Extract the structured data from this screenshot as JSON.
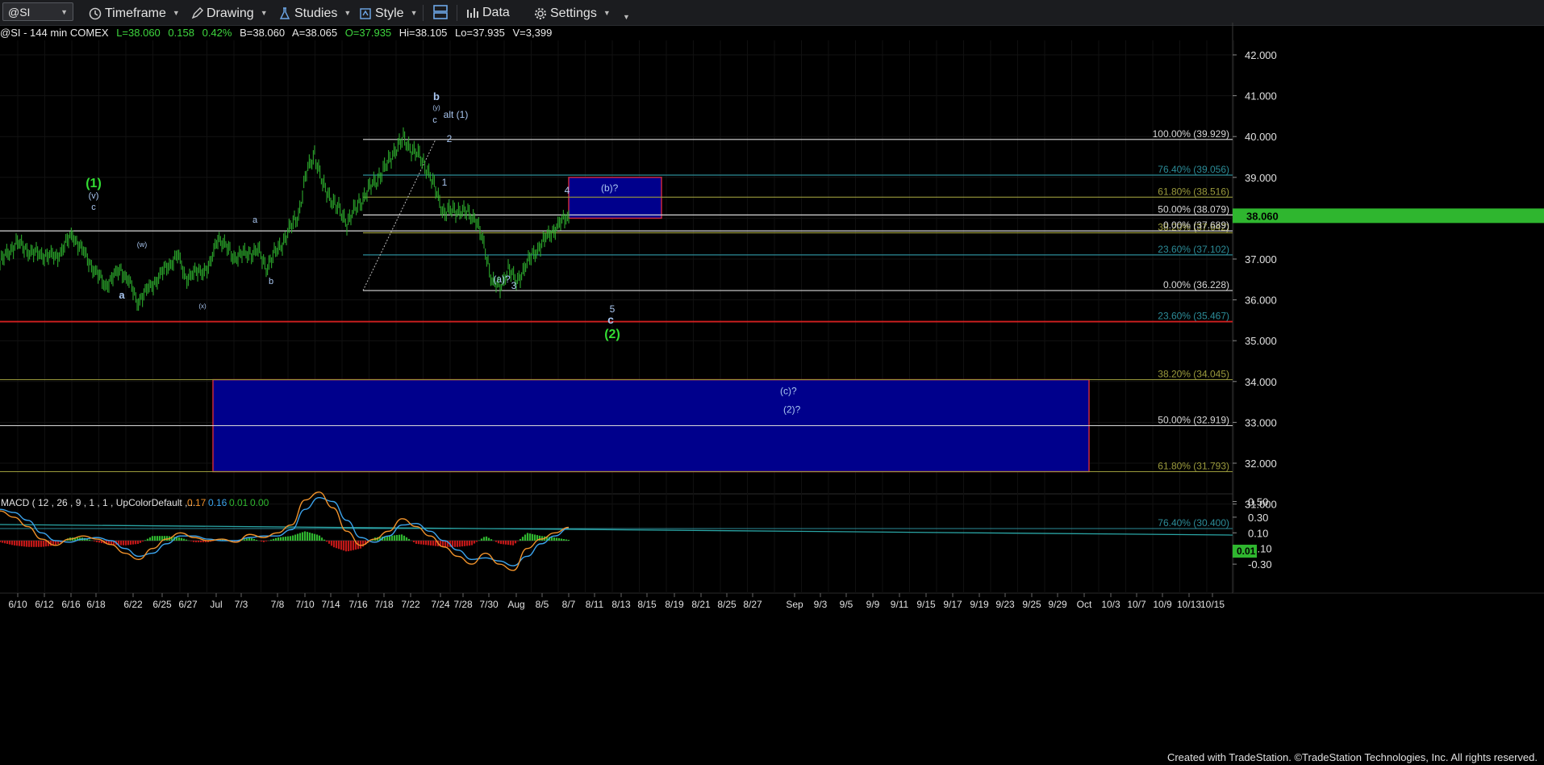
{
  "toolbar": {
    "symbol": "@SI",
    "timeframe_label": "Timeframe",
    "drawing_label": "Drawing",
    "studies_label": "Studies",
    "style_label": "Style",
    "data_label": "Data",
    "settings_label": "Settings"
  },
  "info_bar": {
    "symbol_desc": "@SI - 144 min  COMEX",
    "last": "L=38.060",
    "change": "0.158",
    "change_pct": "0.42%",
    "bid": "B=38.060",
    "ask": "A=38.065",
    "open": "O=37.935",
    "high": "Hi=38.105",
    "low": "Lo=37.935",
    "volume": "V=3,399"
  },
  "colors": {
    "background": "#000000",
    "price_bars": "#2fb62f",
    "fib_white": "#d8d8d8",
    "fib_teal": "#2c8c98",
    "fib_olive": "#9a9a3c",
    "support_red": "#d22020",
    "target_box_fill": "#00008c",
    "target_box_border": "#c8283c",
    "wave_label_green": "#33dd33",
    "wave_label_blue": "#a9c6f0",
    "macd_line": "#f0922b",
    "signal_line": "#3ba3ec",
    "hist_pos": "#2fb62f",
    "hist_neg": "#c01818",
    "trendline": "#2aa6a6",
    "last_price_tag": "#2fb62f"
  },
  "chart_data": [
    {
      "type": "candlestick-ohlc",
      "title": "@SI - 144 min COMEX",
      "ylim": [
        30.2,
        42.6
      ],
      "y_ticks": [
        "42.000",
        "41.000",
        "40.000",
        "39.000",
        "38.000",
        "37.000",
        "36.000",
        "35.000",
        "34.000",
        "33.000",
        "32.000",
        "31.000"
      ],
      "x_tick_labels": [
        "6/10",
        "6/12",
        "6/16",
        "6/18",
        "6/22",
        "6/25",
        "6/27",
        "Jul",
        "7/3",
        "7/8",
        "7/10",
        "7/14",
        "7/16",
        "7/18",
        "7/22",
        "7/24",
        "7/28",
        "7/30",
        "Aug",
        "8/5",
        "8/7",
        "8/11",
        "8/13",
        "8/15",
        "8/19",
        "8/21",
        "8/25",
        "8/27",
        "Sep",
        "9/3",
        "9/5",
        "9/9",
        "9/11",
        "9/15",
        "9/17",
        "9/19",
        "9/23",
        "9/25",
        "9/29",
        "Oct",
        "10/3",
        "10/7",
        "10/9",
        "10/13",
        "10/15"
      ],
      "price_path": [
        [
          0,
          36.9
        ],
        [
          4,
          37.4
        ],
        [
          8,
          37.15
        ],
        [
          14,
          37.05
        ],
        [
          18,
          37.6
        ],
        [
          22,
          36.95
        ],
        [
          26,
          36.35
        ],
        [
          30,
          36.75
        ],
        [
          32,
          36.45
        ],
        [
          34,
          35.95
        ],
        [
          38,
          36.4
        ],
        [
          44,
          37.1
        ],
        [
          46,
          36.55
        ],
        [
          52,
          36.8
        ],
        [
          54,
          37.55
        ],
        [
          58,
          37.05
        ],
        [
          64,
          37.2
        ],
        [
          66,
          36.8
        ],
        [
          70,
          37.4
        ],
        [
          74,
          38.1
        ],
        [
          76,
          39.1
        ],
        [
          78,
          39.6
        ],
        [
          80,
          38.8
        ],
        [
          84,
          38.2
        ],
        [
          86,
          37.9
        ],
        [
          90,
          38.5
        ],
        [
          96,
          39.3
        ],
        [
          98,
          39.7
        ],
        [
          100,
          39.92
        ],
        [
          104,
          39.5
        ],
        [
          106,
          39.2
        ],
        [
          110,
          38.15
        ],
        [
          114,
          38.2
        ],
        [
          118,
          38.0
        ],
        [
          120,
          37.3
        ],
        [
          122,
          36.5
        ],
        [
          124,
          36.25
        ],
        [
          126,
          36.8
        ],
        [
          128,
          36.4
        ],
        [
          130,
          36.8
        ],
        [
          134,
          37.35
        ],
        [
          138,
          37.8
        ],
        [
          141,
          38.06
        ]
      ],
      "last_price": "38.060",
      "fib_levels_upper": [
        {
          "label": "100.00% (39.929)",
          "value": 39.929,
          "color": "white"
        },
        {
          "label": "76.40% (39.056)",
          "value": 39.056,
          "color": "teal"
        },
        {
          "label": "61.80% (38.516)",
          "value": 38.516,
          "color": "olive"
        },
        {
          "label": "50.00% (38.079)",
          "value": 38.079,
          "color": "white"
        },
        {
          "label": "38.20% (37.642)",
          "value": 37.642,
          "color": "olive"
        },
        {
          "label": "23.60% (37.102)",
          "value": 37.102,
          "color": "teal"
        },
        {
          "label": "0.00% (36.228)",
          "value": 36.228,
          "color": "white"
        }
      ],
      "horizontal_line_upper": {
        "label": "0.00% (37.689)",
        "value": 37.689
      },
      "support_line": {
        "label": "23.60% (35.467)",
        "value": 35.467
      },
      "fib_levels_lower": [
        {
          "label": "38.20% (34.045)",
          "value": 34.045,
          "color": "olive"
        },
        {
          "label": "50.00% (32.919)",
          "value": 32.919,
          "color": "white"
        },
        {
          "label": "61.80% (31.793)",
          "value": 31.793,
          "color": "olive"
        },
        {
          "label": "76.40% (30.400)",
          "value": 30.4,
          "color": "teal"
        }
      ],
      "target_boxes": [
        {
          "label": "(b)?",
          "top": 39.0,
          "bottom": 38.0
        },
        {
          "label": "(c)?",
          "label2": "(2)?",
          "top": 34.045,
          "bottom": 31.793
        }
      ],
      "wave_labels": [
        {
          "text": "(1)",
          "color": "green"
        },
        {
          "text": "(v)",
          "color": "blue"
        },
        {
          "text": "c",
          "color": "blue"
        },
        {
          "text": "a",
          "color": "blue"
        },
        {
          "text": "(w)",
          "color": "blue"
        },
        {
          "text": "(x)",
          "color": "blue"
        },
        {
          "text": "a",
          "color": "blue"
        },
        {
          "text": "b",
          "color": "blue"
        },
        {
          "text": "b",
          "color": "blue"
        },
        {
          "text": "(y)",
          "color": "blue"
        },
        {
          "text": "c",
          "color": "blue"
        },
        {
          "text": "alt (1)",
          "color": "blue"
        },
        {
          "text": "2",
          "color": "blue"
        },
        {
          "text": "1",
          "color": "blue"
        },
        {
          "text": "4",
          "color": "blue"
        },
        {
          "text": "(a)?",
          "color": "blue"
        },
        {
          "text": "3",
          "color": "blue"
        },
        {
          "text": "5",
          "color": "blue"
        },
        {
          "text": "c",
          "color": "blue"
        },
        {
          "text": "(2)",
          "color": "green"
        }
      ]
    },
    {
      "type": "line",
      "title": "MACD ( 12 , 26 , 9 , 1 , 1 , UpColorDefault ,...",
      "legend_values": [
        "0.17",
        "0.16",
        "0.01",
        "0.00"
      ],
      "ylim": [
        -0.42,
        0.65
      ],
      "y_ticks": [
        "0.50",
        "0.30",
        "0.10",
        "-0.10",
        "-0.30"
      ],
      "current_value": "0.01",
      "series": [
        {
          "values": [
            0.38,
            0.3,
            0.18,
            0.02,
            -0.06,
            0.02,
            0.06,
            0.02,
            -0.05,
            -0.16,
            -0.24,
            -0.1,
            0.02,
            0.1,
            0.04,
            0.0,
            0.02,
            -0.02,
            0.08,
            0.04,
            0.1,
            0.2,
            0.52,
            0.62,
            0.42,
            0.12,
            -0.06,
            0.02,
            0.12,
            0.28,
            0.18,
            0.06,
            -0.08,
            -0.2,
            -0.3,
            -0.16,
            -0.3,
            -0.38,
            -0.1,
            0.02,
            0.1,
            0.17
          ]
        },
        {
          "values": [
            0.4,
            0.36,
            0.26,
            0.1,
            0.0,
            -0.02,
            0.02,
            0.04,
            0.0,
            -0.1,
            -0.2,
            -0.16,
            -0.04,
            0.06,
            0.06,
            0.02,
            0.0,
            0.0,
            0.04,
            0.06,
            0.06,
            0.14,
            0.4,
            0.55,
            0.5,
            0.26,
            0.04,
            -0.02,
            0.06,
            0.2,
            0.22,
            0.12,
            0.0,
            -0.12,
            -0.24,
            -0.22,
            -0.26,
            -0.32,
            -0.2,
            -0.04,
            0.06,
            0.16
          ]
        },
        {
          "values": [
            -0.02,
            -0.06,
            -0.08,
            -0.08,
            -0.06,
            0.04,
            0.04,
            -0.02,
            -0.05,
            -0.06,
            -0.04,
            0.06,
            0.06,
            0.04,
            -0.02,
            -0.02,
            0.02,
            -0.02,
            0.04,
            -0.02,
            0.04,
            0.06,
            0.12,
            0.07,
            -0.08,
            -0.14,
            -0.1,
            0.04,
            0.06,
            0.08,
            -0.04,
            -0.06,
            -0.08,
            -0.08,
            -0.06,
            0.06,
            -0.04,
            -0.06,
            0.1,
            0.06,
            0.04,
            0.01
          ]
        }
      ]
    }
  ],
  "footer": "Created with TradeStation. ©TradeStation Technologies, Inc. All rights reserved."
}
